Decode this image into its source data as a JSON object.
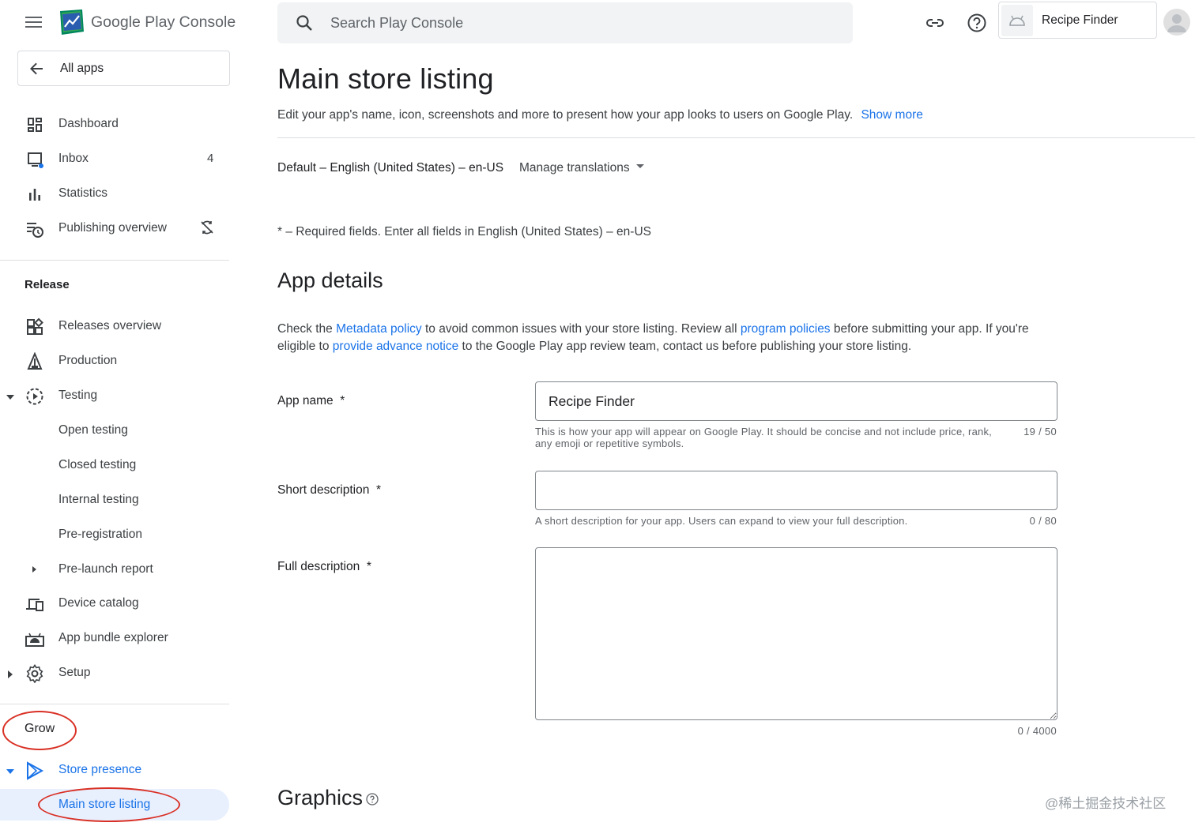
{
  "header": {
    "brand_google_play": "Google Play",
    "brand_console": "Console",
    "search_placeholder": "Search Play Console",
    "app_chip_name": "Recipe Finder"
  },
  "sidebar": {
    "all_apps": "All apps",
    "top_items": [
      {
        "label": "Dashboard",
        "icon": "dashboard-icon"
      },
      {
        "label": "Inbox",
        "icon": "inbox-icon",
        "badge": "4"
      },
      {
        "label": "Statistics",
        "icon": "bar-chart-icon"
      },
      {
        "label": "Publishing overview",
        "icon": "schedule-list-icon",
        "trail_icon": "sync-disabled-icon"
      }
    ],
    "release_title": "Release",
    "release_items": [
      {
        "label": "Releases overview"
      },
      {
        "label": "Production"
      },
      {
        "label": "Testing"
      },
      {
        "label": "Open testing"
      },
      {
        "label": "Closed testing"
      },
      {
        "label": "Internal testing"
      },
      {
        "label": "Pre-registration"
      },
      {
        "label": "Pre-launch report"
      },
      {
        "label": "Device catalog"
      },
      {
        "label": "App bundle explorer"
      },
      {
        "label": "Setup"
      }
    ],
    "grow_title": "Grow",
    "grow_items": [
      {
        "label": "Store presence"
      },
      {
        "label": "Main store listing"
      }
    ]
  },
  "main": {
    "title": "Main store listing",
    "subtitle": "Edit your app's name, icon, screenshots and more to present how your app looks to users on Google Play.",
    "show_more": "Show more",
    "language": "Default – English (United States) – en-US",
    "manage_translations": "Manage translations",
    "required_note": "* – Required fields. Enter all fields in English (United States) – en-US",
    "app_details_title": "App details",
    "policy_text": {
      "p1": "Check the ",
      "link1": "Metadata policy",
      "p2": " to avoid common issues with your store listing. Review all ",
      "link2": "program policies",
      "p3": " before submitting your app. If you're eligible to ",
      "link3": "provide advance notice",
      "p4": " to the Google Play app review team, contact us before publishing your store listing."
    },
    "fields": {
      "app_name": {
        "label": "App name",
        "required_mark": "*",
        "value": "Recipe Finder",
        "hint": "This is how your app will appear on Google Play. It should be concise and not include price, rank, any emoji or repetitive symbols.",
        "counter": "19 / 50"
      },
      "short_description": {
        "label": "Short description",
        "required_mark": "*",
        "value": "",
        "hint": "A short description for your app. Users can expand to view your full description.",
        "counter": "0 / 80"
      },
      "full_description": {
        "label": "Full description",
        "required_mark": "*",
        "value": "",
        "counter": "0 / 4000"
      }
    },
    "graphics_title": "Graphics"
  },
  "watermark": "@稀土掘金技术社区",
  "colors": {
    "accent": "#1a73e8",
    "annotation_red": "#d93025",
    "selected_bg": "#e8f0fe"
  }
}
